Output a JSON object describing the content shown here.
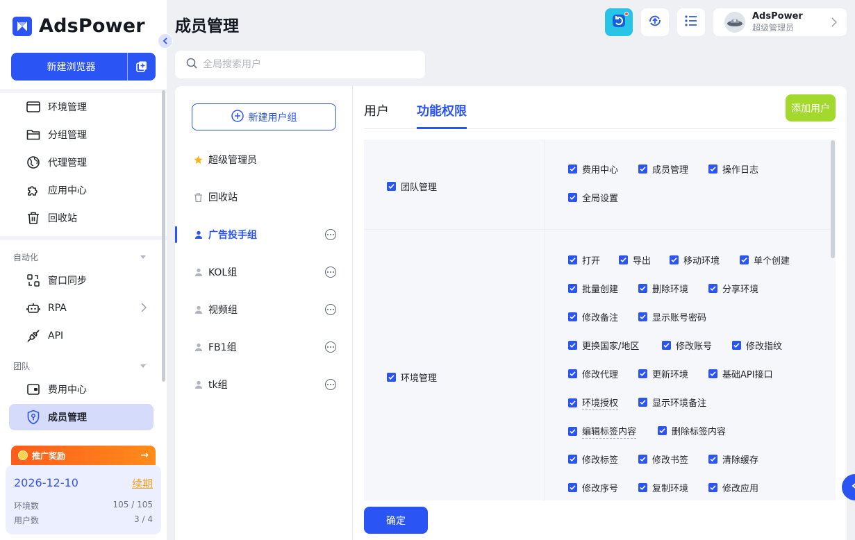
{
  "app": {
    "name": "AdsPower"
  },
  "sidebar": {
    "new_browser_label": "新建浏览器",
    "items": [
      {
        "label": "环境管理"
      },
      {
        "label": "分组管理"
      },
      {
        "label": "代理管理"
      },
      {
        "label": "应用中心"
      },
      {
        "label": "回收站"
      }
    ],
    "automation": {
      "title": "自动化",
      "items": [
        {
          "label": "窗口同步"
        },
        {
          "label": "RPA"
        },
        {
          "label": "API"
        }
      ]
    },
    "team": {
      "title": "团队",
      "items": [
        {
          "label": "费用中心"
        },
        {
          "label": "成员管理"
        }
      ]
    },
    "promo_label": "推广奖励",
    "plan": {
      "date": "2026-12-10",
      "renew": "续期",
      "env_label": "环境数",
      "env_value": "105 / 105",
      "user_label": "用户数",
      "user_value": "3 / 4"
    }
  },
  "header": {
    "title": "成员管理",
    "user_name": "AdsPower",
    "user_role": "超级管理员"
  },
  "search": {
    "placeholder": "全局搜索用户"
  },
  "groups": {
    "new_group_label": "新建用户组",
    "items": [
      {
        "label": "超级管理员"
      },
      {
        "label": "回收站"
      },
      {
        "label": "广告投手组"
      },
      {
        "label": "KOL组"
      },
      {
        "label": "视频组"
      },
      {
        "label": "FB1组"
      },
      {
        "label": "tk组"
      }
    ]
  },
  "tabs": {
    "users": "用户",
    "permissions": "功能权限",
    "add_user": "添加用户"
  },
  "permissions": {
    "team": {
      "label": "团队管理",
      "items": [
        "费用中心",
        "成员管理",
        "操作日志",
        "全局设置"
      ]
    },
    "env": {
      "label": "环境管理",
      "items": [
        "打开",
        "导出",
        "移动环境",
        "单个创建",
        "批量创建",
        "删除环境",
        "分享环境",
        "修改备注",
        "显示账号密码",
        "更换国家/地区",
        "修改账号",
        "修改指纹",
        "修改代理",
        "更新环境",
        "基础API接口",
        "环境授权",
        "显示环境备注",
        "编辑标签内容",
        "删除标签内容",
        "修改标签",
        "修改书签",
        "清除缓存",
        "修改序号",
        "复制环境",
        "修改应用"
      ]
    },
    "confirm_label": "确定"
  },
  "colors": {
    "primary": "#2b54f5",
    "add_user": "#a3d92d",
    "promo": "#ff6a1a",
    "renew": "#f5a020"
  }
}
